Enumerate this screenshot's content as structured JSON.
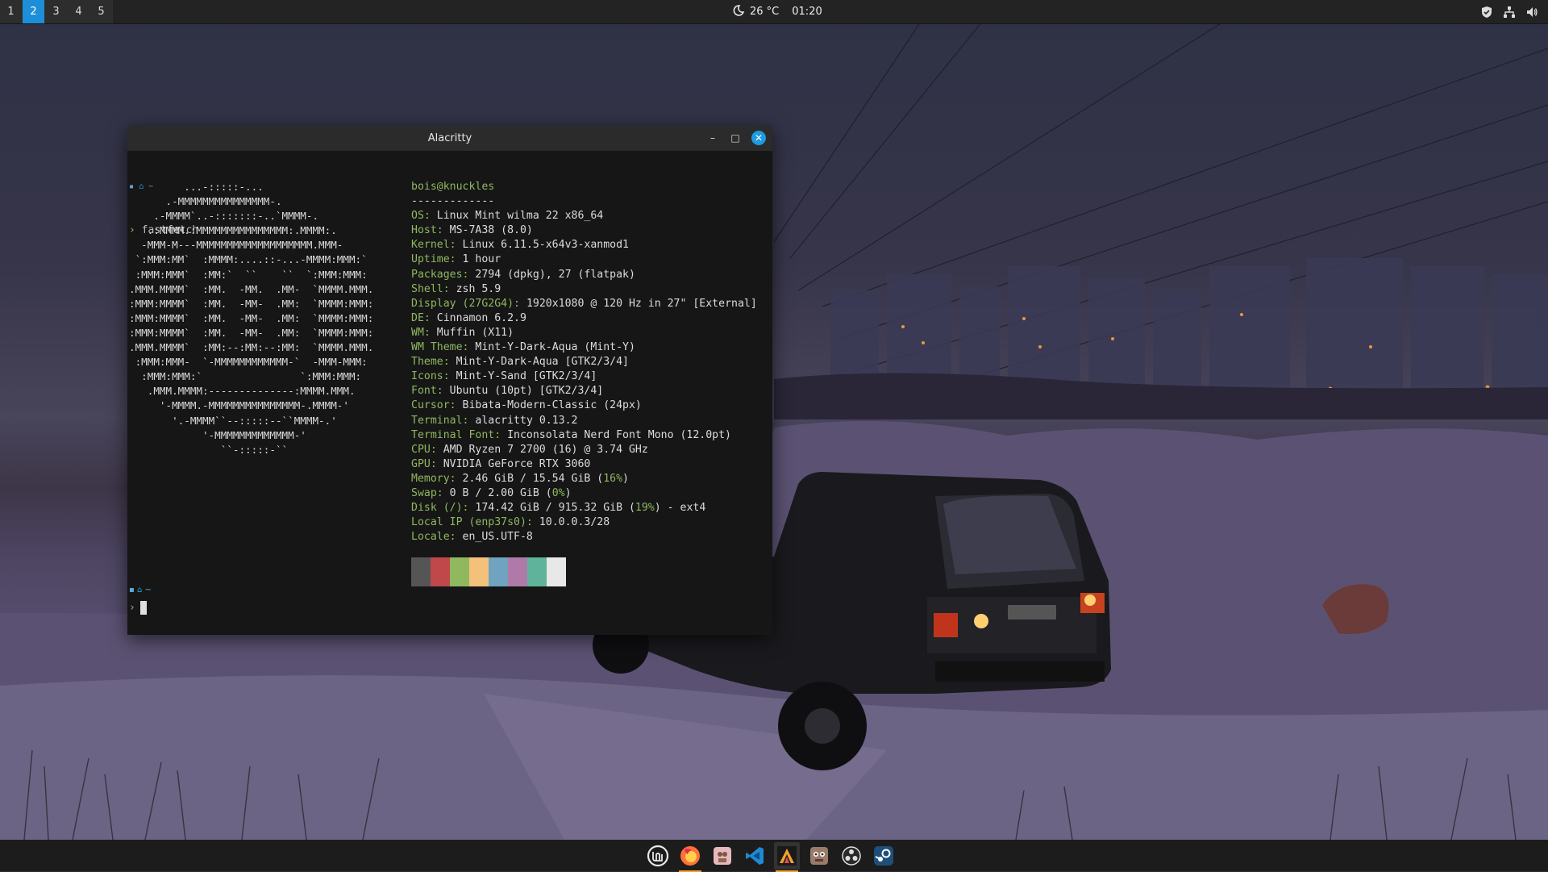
{
  "top_panel": {
    "workspaces": [
      "1",
      "2",
      "3",
      "4",
      "5"
    ],
    "active_workspace": "2",
    "weather": "26 °C",
    "time": "01:20"
  },
  "window": {
    "title": "Alacritty",
    "minimize": "–",
    "maximize": "□",
    "close": "✕"
  },
  "terminal": {
    "prompt_dir": "~",
    "command": "fastfetch",
    "ascii_logo": [
      "         ...-:::::-...",
      "      .-MMMMMMMMMMMMMMM-.",
      "    .-MMMM`..-:::::::-..`MMMM-.",
      "   .:MMMM.:MMMMMMMMMMMMMMM:.MMMM:.",
      "  -MMM-M---MMMMMMMMMMMMMMMMMMM.MMM-",
      " `:MMM:MM`  :MMMM:....::-...-MMMM:MMM:`",
      " :MMM:MMM`  :MM:`  ``    ``  `:MMM:MMM:",
      ".MMM.MMMM`  :MM.  -MM.  .MM-  `MMMM.MMM.",
      ":MMM:MMMM`  :MM.  -MM-  .MM:  `MMMM:MMM:",
      ":MMM:MMMM`  :MM.  -MM-  .MM:  `MMMM:MMM:",
      ":MMM:MMMM`  :MM.  -MM-  .MM:  `MMMM:MMM:",
      ".MMM.MMMM`  :MM:--:MM:--:MM:  `MMMM.MMM.",
      " :MMM:MMM-  `-MMMMMMMMMMMM-`  -MMM-MMM:",
      "  :MMM:MMM:`                `:MMM:MMM:",
      "   .MMM.MMMM:--------------:MMMM.MMM.",
      "     '-MMMM.-MMMMMMMMMMMMMMM-.MMMM-'",
      "       '.-MMMM``--:::::--``MMMM-.'",
      "            '-MMMMMMMMMMMMM-'",
      "               ``-:::::-``"
    ],
    "user_host": "bois@knuckles",
    "separator": "-------------",
    "info": [
      {
        "key": "OS",
        "value": "Linux Mint wilma 22 x86_64"
      },
      {
        "key": "Host",
        "value": "MS-7A38 (8.0)"
      },
      {
        "key": "Kernel",
        "value": "Linux 6.11.5-x64v3-xanmod1"
      },
      {
        "key": "Uptime",
        "value": "1 hour"
      },
      {
        "key": "Packages",
        "value": "2794 (dpkg), 27 (flatpak)"
      },
      {
        "key": "Shell",
        "value": "zsh 5.9"
      },
      {
        "key": "Display (27G2G4)",
        "value": "1920x1080 @ 120 Hz in 27\" [External]"
      },
      {
        "key": "DE",
        "value": "Cinnamon 6.2.9"
      },
      {
        "key": "WM",
        "value": "Muffin (X11)"
      },
      {
        "key": "WM Theme",
        "value": "Mint-Y-Dark-Aqua (Mint-Y)"
      },
      {
        "key": "Theme",
        "value": "Mint-Y-Dark-Aqua [GTK2/3/4]"
      },
      {
        "key": "Icons",
        "value": "Mint-Y-Sand [GTK2/3/4]"
      },
      {
        "key": "Font",
        "value": "Ubuntu (10pt) [GTK2/3/4]"
      },
      {
        "key": "Cursor",
        "value": "Bibata-Modern-Classic (24px)"
      },
      {
        "key": "Terminal",
        "value": "alacritty 0.13.2"
      },
      {
        "key": "Terminal Font",
        "value": "Inconsolata Nerd Font Mono (12.0pt)"
      },
      {
        "key": "CPU",
        "value": "AMD Ryzen 7 2700 (16) @ 3.74 GHz"
      },
      {
        "key": "GPU",
        "value": "NVIDIA GeForce RTX 3060"
      }
    ],
    "memory": {
      "key": "Memory",
      "value": "2.46 GiB / 15.54 GiB (",
      "pct": "16%",
      "suffix": ")"
    },
    "swap": {
      "key": "Swap",
      "value": "0 B / 2.00 GiB (",
      "pct": "0%",
      "suffix": ")"
    },
    "disk": {
      "key": "Disk (/)",
      "value": "174.42 GiB / 915.32 GiB (",
      "pct": "19%",
      "suffix": ") - ext4"
    },
    "local_ip": {
      "key": "Local IP (enp37s0)",
      "value": "10.0.0.3/28"
    },
    "locale": {
      "key": "Locale",
      "value": "en_US.UTF-8"
    },
    "palette": [
      "#555555",
      "#c0484a",
      "#8fb85f",
      "#f3c17a",
      "#6fa3c0",
      "#b07aa8",
      "#5fb39a",
      "#e8e8e8"
    ]
  },
  "dock": {
    "items": [
      "mint-menu-icon",
      "firefox-icon",
      "gimp-icon",
      "vscode-icon",
      "alacritty-icon",
      "gnome-boxes-icon",
      "obs-icon",
      "steam-icon"
    ]
  }
}
